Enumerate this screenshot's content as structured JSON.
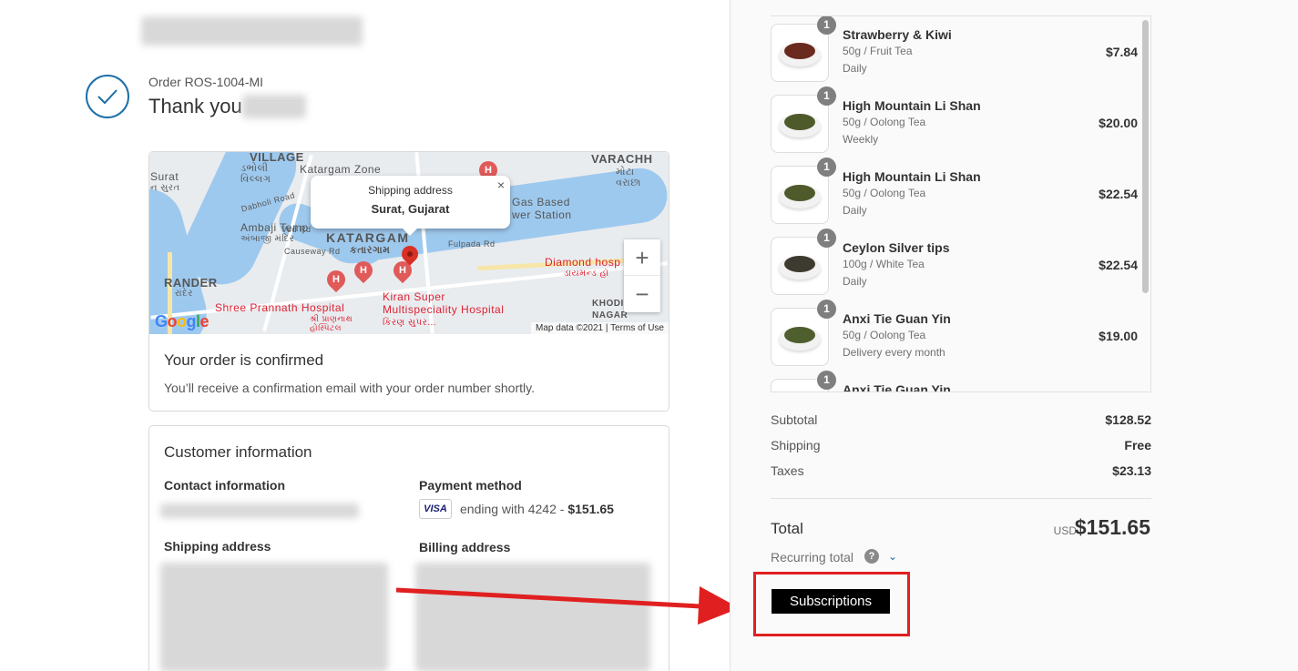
{
  "order": {
    "number": "Order ROS-1004-MI",
    "thank_you": "Thank you"
  },
  "map": {
    "popup_title": "Shipping address",
    "popup_city": "Surat, Gujarat",
    "popup_close": "×",
    "zoom_in": "+",
    "zoom_out": "−",
    "attribution": "Map data ©2021 | Terms of Use",
    "google": "Google",
    "labels": {
      "village": "VILLAGE",
      "village_guj": "ડભોલી\nવિલ્લગ",
      "katargam_zone": "Katargam Zone",
      "varachha": "VARACHH",
      "varachha_guj": "મોટા\nવરાછા",
      "surat": "Surat",
      "surat_guj": "ન સુરત",
      "dabholi_road": "Dabholi Road",
      "ved_rd": "Ved Rd",
      "gas_based": "Gas Based",
      "power_station": "wer Station",
      "ambaji": "Ambaji Temp",
      "ambaji_guj": "અંબાજી મંદિર",
      "katargam": "KATARGAM",
      "katargam_guj": "કતારગામ",
      "fulpada": "Fulpada Rd",
      "causeway": "Causeway Rd",
      "rander": "RANDER",
      "rander_guj": "રાંદેર",
      "diamond": "Diamond hosp",
      "diamond_guj": "ડાયમન્ડ હૉ",
      "shree": "Shree Prannath Hospital",
      "shree_guj": "શ્રી પ્રાણનાથ\nહોસ્પિટલ",
      "kiran": "Kiran Super\nMultispeciality Hospital",
      "kiran_guj": "કિરણ સુપર...",
      "khodiy": "KHODIY\nNAGAR",
      "pin_h": "H"
    }
  },
  "confirm": {
    "title": "Your order is confirmed",
    "text": "You’ll receive a confirmation email with your order number shortly."
  },
  "customer": {
    "title": "Customer information",
    "contact_label": "Contact information",
    "payment_label": "Payment method",
    "card_brand": "VISA",
    "payment_text": "ending with 4242 - ",
    "payment_amount": "$151.65",
    "shipping_label": "Shipping address",
    "billing_label": "Billing address"
  },
  "products": [
    {
      "qty": "1",
      "name": "Strawberry & Kiwi",
      "variant": "50g / Fruit Tea",
      "frequency": "Daily",
      "price": "$7.84",
      "color": "#6b2a1e"
    },
    {
      "qty": "1",
      "name": "High Mountain Li Shan",
      "variant": "50g / Oolong Tea",
      "frequency": "Weekly",
      "price": "$20.00",
      "color": "#4f5a2a"
    },
    {
      "qty": "1",
      "name": "High Mountain Li Shan",
      "variant": "50g / Oolong Tea",
      "frequency": "Daily",
      "price": "$22.54",
      "color": "#4f5a2a"
    },
    {
      "qty": "1",
      "name": "Ceylon Silver tips",
      "variant": "100g / White Tea",
      "frequency": "Daily",
      "price": "$22.54",
      "color": "#3d3a30"
    },
    {
      "qty": "1",
      "name": "Anxi Tie Guan Yin",
      "variant": "50g / Oolong Tea",
      "frequency": "Delivery every month",
      "price": "$19.00",
      "color": "#4e5e2c"
    },
    {
      "qty": "1",
      "name": "Anxi Tie Guan Yin",
      "variant": "",
      "frequency": "",
      "price": "",
      "color": "#4e5e2c"
    }
  ],
  "summary": {
    "subtotal_label": "Subtotal",
    "subtotal": "$128.52",
    "shipping_label": "Shipping",
    "shipping": "Free",
    "taxes_label": "Taxes",
    "taxes": "$23.13",
    "total_label": "Total",
    "currency": "USD",
    "total": "$151.65",
    "recurring_label": "Recurring total",
    "help": "?",
    "chevron": "⌄"
  },
  "subscriptions_button": "Subscriptions",
  "colors": {
    "accent": "#1f6fa8",
    "annotation_red": "#e02020"
  }
}
